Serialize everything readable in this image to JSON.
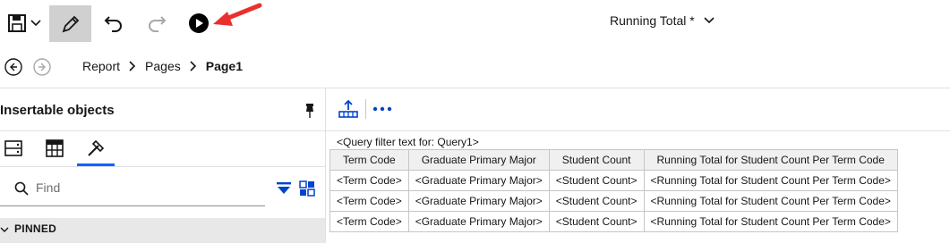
{
  "toolbar": {
    "save_icon": "save-icon",
    "save_menu_icon": "chevron-down-icon",
    "edit_icon": "pencil-icon",
    "undo_icon": "undo-icon",
    "redo_icon": "redo-icon",
    "run_icon": "play-icon",
    "annotation_icon": "red-arrow-icon",
    "annotation_color": "#e8312f",
    "document_title": "Running Total *",
    "title_menu_icon": "chevron-down-icon"
  },
  "nav": {
    "back_icon": "arrow-left-circle-icon",
    "forward_icon": "arrow-right-circle-icon",
    "breadcrumb": [
      "Report",
      "Pages",
      "Page1"
    ]
  },
  "left_panel": {
    "title": "Insertable objects",
    "pin_icon": "pin-icon",
    "tabs": [
      "data-source-icon",
      "toolbox-icon",
      "hammer-icon"
    ],
    "active_tab": 2,
    "search_placeholder": "Find",
    "filter_icon": "filter-icon",
    "view_toggle_icon": "grid-view-icon",
    "pinned_label": "PINNED"
  },
  "report": {
    "toolbar_icons": [
      "upload-icon",
      "more-icon"
    ],
    "query_filter_text": "<Query filter text for: Query1>",
    "table": {
      "headers": [
        "Term Code",
        "Graduate Primary Major",
        "Student Count",
        "Running Total for Student Count Per Term Code"
      ],
      "rows": [
        [
          "<Term Code>",
          "<Graduate Primary Major>",
          "<Student Count>",
          "<Running Total for Student Count Per Term Code>"
        ],
        [
          "<Term Code>",
          "<Graduate Primary Major>",
          "<Student Count>",
          "<Running Total for Student Count Per Term Code>"
        ],
        [
          "<Term Code>",
          "<Graduate Primary Major>",
          "<Student Count>",
          "<Running Total for Student Count Per Term Code>"
        ]
      ]
    }
  },
  "colors": {
    "accent": "#0f62fe",
    "active_tab_underline": "#0f62fe",
    "link_blue": "#0043ce"
  }
}
